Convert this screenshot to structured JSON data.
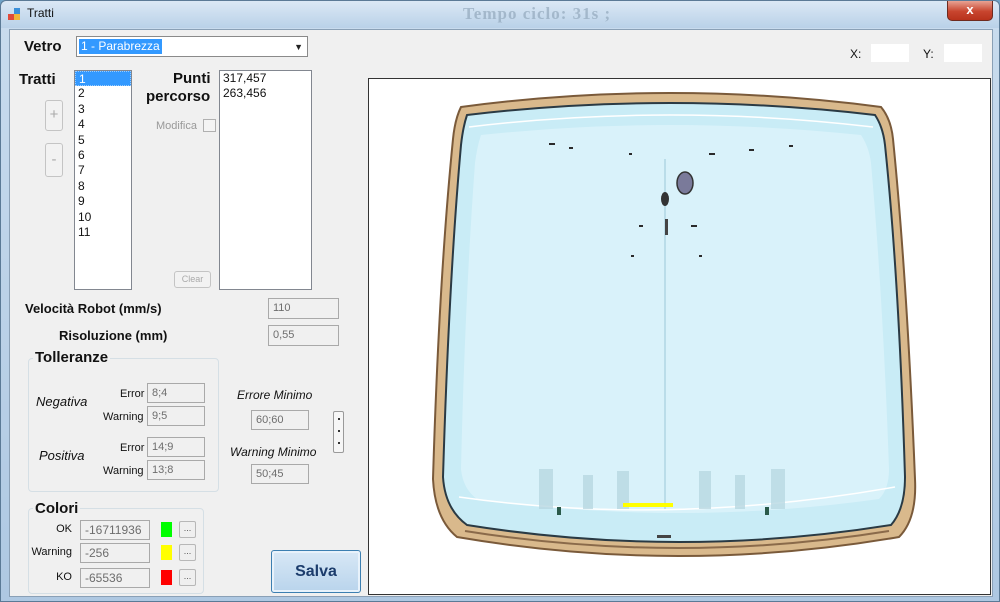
{
  "window": {
    "title": "Tratti",
    "background_caption": "Tempo ciclo: 31s ;",
    "close_label": "x"
  },
  "vetro": {
    "label": "Vetro",
    "selected": "1 - Parabrezza"
  },
  "coords": {
    "x_label": "X:",
    "x_value": "",
    "y_label": "Y:",
    "y_value": ""
  },
  "tratti": {
    "label": "Tratti",
    "items": [
      "1",
      "2",
      "3",
      "4",
      "5",
      "6",
      "7",
      "8",
      "9",
      "10",
      "11"
    ],
    "selected_index": 0,
    "add_label": "+",
    "remove_label": "-"
  },
  "punti": {
    "label_line1": "Punti",
    "label_line2": "percorso",
    "items": [
      "317,457",
      "263,456"
    ],
    "modifica_label": "Modifica",
    "clear_label": "Clear"
  },
  "params": {
    "velocita_label": "Velocità Robot (mm/s)",
    "velocita_value": "110",
    "risoluzione_label": "Risoluzione (mm)",
    "risoluzione_value": "0,55"
  },
  "tolleranze": {
    "title": "Tolleranze",
    "negativa_label": "Negativa",
    "positiva_label": "Positiva",
    "error_label": "Error",
    "warning_label": "Warning",
    "neg_error": "8;4",
    "neg_warning": "9;5",
    "pos_error": "14;9",
    "pos_warning": "13;8",
    "errore_minimo_label": "Errore Minimo",
    "errore_minimo_value": "60;60",
    "warning_minimo_label": "Warning Minimo",
    "warning_minimo_value": "50;45"
  },
  "colori": {
    "title": "Colori",
    "rows": [
      {
        "label": "OK",
        "value": "-16711936",
        "color": "#00ff00"
      },
      {
        "label": "Warning",
        "value": "-256",
        "color": "#ffff00"
      },
      {
        "label": "KO",
        "value": "-65536",
        "color": "#ff0000"
      }
    ],
    "dots_label": "..."
  },
  "salva_label": "Salva",
  "colors": {
    "selection": "#3399ff",
    "glass": "#c9ecf6",
    "frame": "#d7b98a"
  }
}
